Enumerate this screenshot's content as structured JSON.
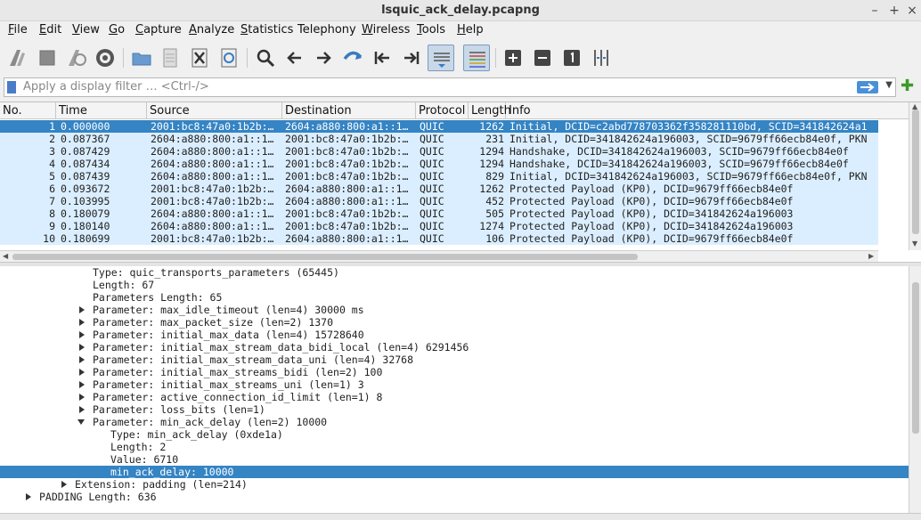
{
  "window": {
    "title": "lsquic_ack_delay.pcapng",
    "controls": [
      "–",
      "+",
      "×"
    ]
  },
  "menu": [
    {
      "key": "F",
      "rest": "ile"
    },
    {
      "key": "E",
      "rest": "dit"
    },
    {
      "key": "V",
      "rest": "iew"
    },
    {
      "key": "G",
      "rest": "o"
    },
    {
      "key": "C",
      "rest": "apture"
    },
    {
      "key": "A",
      "rest": "nalyze"
    },
    {
      "key": "S",
      "rest": "tatistics"
    },
    {
      "key": "",
      "rest": "Telephony"
    },
    {
      "key": "W",
      "rest": "ireless"
    },
    {
      "key": "T",
      "rest": "ools"
    },
    {
      "key": "H",
      "rest": "elp"
    }
  ],
  "toolbar": {
    "icons": [
      "shark-fin-start-icon",
      "stop-icon",
      "restart-capture-icon",
      "capture-options-icon",
      "open-folder-icon",
      "file-icon",
      "close-file-icon",
      "reload-icon",
      "search-icon",
      "back-arrow-icon",
      "forward-arrow-icon",
      "go-to-packet-icon",
      "first-packet-icon",
      "last-packet-icon",
      "autoscroll-icon",
      "colorize-icon",
      "zoom-in-icon",
      "zoom-out-icon",
      "normal-size-icon",
      "resize-columns-icon"
    ]
  },
  "filter": {
    "placeholder": "Apply a display filter … <Ctrl-/>"
  },
  "packet_list": {
    "columns": [
      "No.",
      "Time",
      "Source",
      "Destination",
      "Protocol",
      "Length",
      "Info"
    ],
    "rows": [
      {
        "no": "1",
        "time": "0.000000",
        "src": "2001:bc8:47a0:1b2b:…",
        "dst": "2604:a880:800:a1::1…",
        "proto": "QUIC",
        "len": "1262",
        "info": "Initial, DCID=c2abd778703362f358281110bd, SCID=341842624a1"
      },
      {
        "no": "2",
        "time": "0.087367",
        "src": "2604:a880:800:a1::1…",
        "dst": "2001:bc8:47a0:1b2b:…",
        "proto": "QUIC",
        "len": "231",
        "info": "Initial, DCID=341842624a196003, SCID=9679ff66ecb84e0f, PKN"
      },
      {
        "no": "3",
        "time": "0.087429",
        "src": "2604:a880:800:a1::1…",
        "dst": "2001:bc8:47a0:1b2b:…",
        "proto": "QUIC",
        "len": "1294",
        "info": "Handshake, DCID=341842624a196003, SCID=9679ff66ecb84e0f"
      },
      {
        "no": "4",
        "time": "0.087434",
        "src": "2604:a880:800:a1::1…",
        "dst": "2001:bc8:47a0:1b2b:…",
        "proto": "QUIC",
        "len": "1294",
        "info": "Handshake, DCID=341842624a196003, SCID=9679ff66ecb84e0f"
      },
      {
        "no": "5",
        "time": "0.087439",
        "src": "2604:a880:800:a1::1…",
        "dst": "2001:bc8:47a0:1b2b:…",
        "proto": "QUIC",
        "len": "829",
        "info": "Initial, DCID=341842624a196003, SCID=9679ff66ecb84e0f, PKN"
      },
      {
        "no": "6",
        "time": "0.093672",
        "src": "2001:bc8:47a0:1b2b:…",
        "dst": "2604:a880:800:a1::1…",
        "proto": "QUIC",
        "len": "1262",
        "info": "Protected Payload (KP0), DCID=9679ff66ecb84e0f"
      },
      {
        "no": "7",
        "time": "0.103995",
        "src": "2001:bc8:47a0:1b2b:…",
        "dst": "2604:a880:800:a1::1…",
        "proto": "QUIC",
        "len": "452",
        "info": "Protected Payload (KP0), DCID=9679ff66ecb84e0f"
      },
      {
        "no": "8",
        "time": "0.180079",
        "src": "2604:a880:800:a1::1…",
        "dst": "2001:bc8:47a0:1b2b:…",
        "proto": "QUIC",
        "len": "505",
        "info": "Protected Payload (KP0), DCID=341842624a196003"
      },
      {
        "no": "9",
        "time": "0.180140",
        "src": "2604:a880:800:a1::1…",
        "dst": "2001:bc8:47a0:1b2b:…",
        "proto": "QUIC",
        "len": "1274",
        "info": "Protected Payload (KP0), DCID=341842624a196003"
      },
      {
        "no": "10",
        "time": "0.180699",
        "src": "2001:bc8:47a0:1b2b:…",
        "dst": "2604:a880:800:a1::1…",
        "proto": "QUIC",
        "len": "106",
        "info": "Protected Payload (KP0), DCID=9679ff66ecb84e0f"
      }
    ]
  },
  "details": {
    "lines": [
      {
        "text": "Type: quic_transports_parameters (65445)",
        "toggle": "",
        "indent": 104
      },
      {
        "text": "Length: 67",
        "toggle": "",
        "indent": 104
      },
      {
        "text": "Parameters Length: 65",
        "toggle": "",
        "indent": 104
      },
      {
        "text": "Parameter: max_idle_timeout (len=4) 30000 ms",
        "toggle": "r",
        "indent": 104
      },
      {
        "text": "Parameter: max_packet_size (len=2) 1370",
        "toggle": "r",
        "indent": 104
      },
      {
        "text": "Parameter: initial_max_data (len=4) 15728640",
        "toggle": "r",
        "indent": 104
      },
      {
        "text": "Parameter: initial_max_stream_data_bidi_local (len=4) 6291456",
        "toggle": "r",
        "indent": 104
      },
      {
        "text": "Parameter: initial_max_stream_data_uni (len=4) 32768",
        "toggle": "r",
        "indent": 104
      },
      {
        "text": "Parameter: initial_max_streams_bidi (len=2) 100",
        "toggle": "r",
        "indent": 104
      },
      {
        "text": "Parameter: initial_max_streams_uni (len=1) 3",
        "toggle": "r",
        "indent": 104
      },
      {
        "text": "Parameter: active_connection_id_limit (len=1) 8",
        "toggle": "r",
        "indent": 104
      },
      {
        "text": "Parameter: loss_bits (len=1)",
        "toggle": "r",
        "indent": 104
      },
      {
        "text": "Parameter: min_ack_delay (len=2) 10000",
        "toggle": "d",
        "indent": 104
      },
      {
        "text": "Type: min_ack_delay (0xde1a)",
        "toggle": "",
        "indent": 124
      },
      {
        "text": "Length: 2",
        "toggle": "",
        "indent": 124
      },
      {
        "text": "Value: 6710",
        "toggle": "",
        "indent": 124
      },
      {
        "text": "min_ack_delay: 10000",
        "toggle": "",
        "indent": 124,
        "selected": true
      },
      {
        "text": "Extension: padding (len=214)",
        "toggle": "r",
        "indent": 84
      },
      {
        "text": "PADDING Length: 636",
        "toggle": "r",
        "indent": 44
      }
    ]
  },
  "colors": {
    "row_bg": "#dbeeff",
    "selection": "#3584c4"
  }
}
